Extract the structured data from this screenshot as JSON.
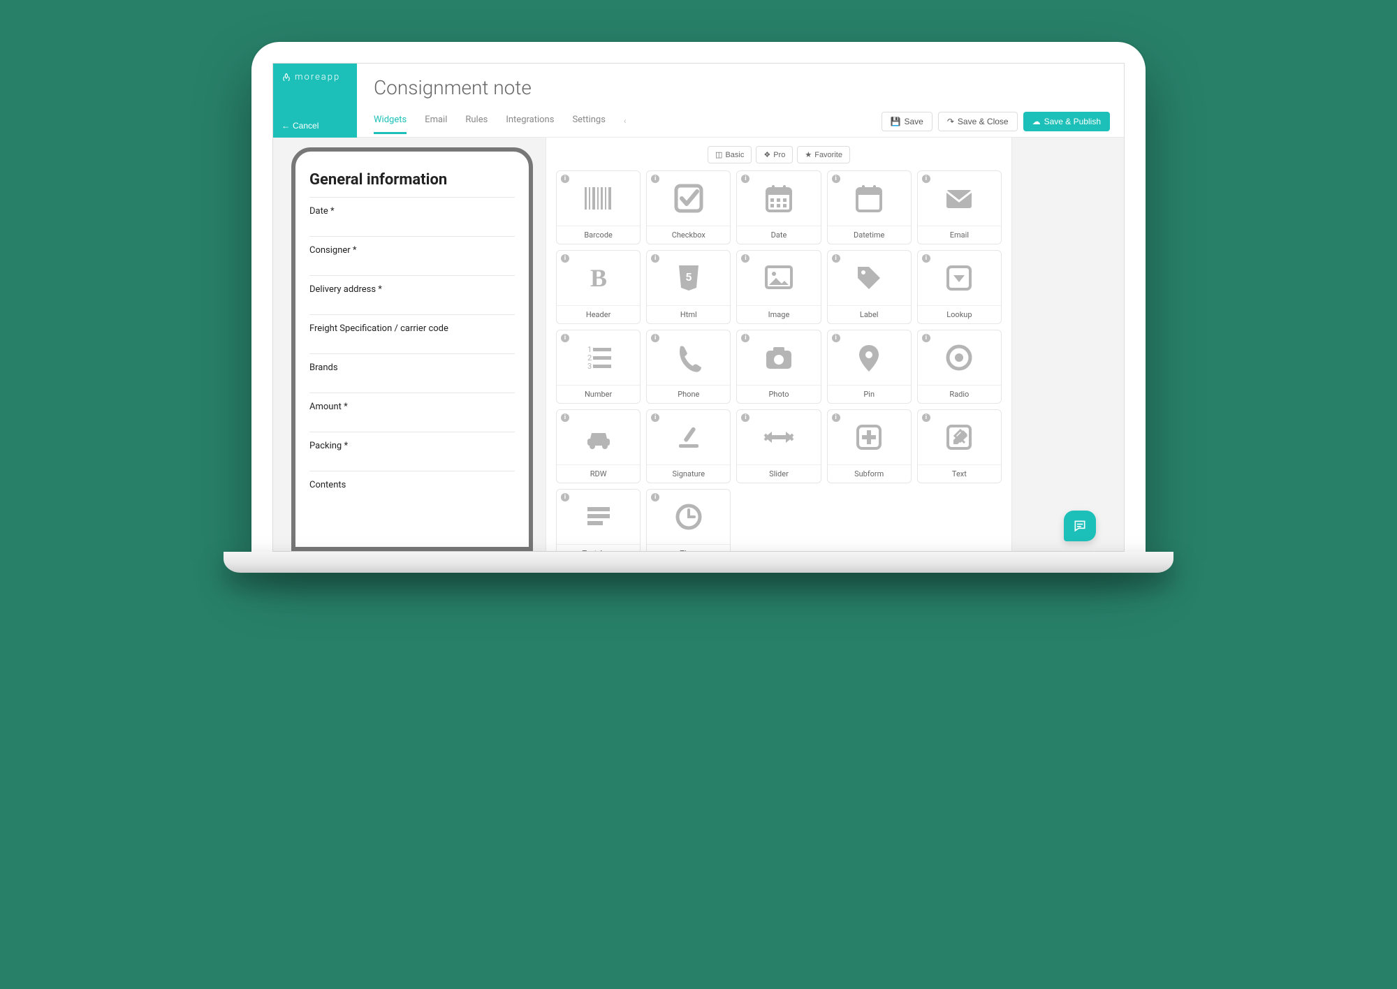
{
  "brand": "moreapp",
  "header": {
    "cancel": "Cancel",
    "title": "Consignment note",
    "tabs": [
      "Widgets",
      "Email",
      "Rules",
      "Integrations",
      "Settings"
    ],
    "active_tab": 0,
    "actions": {
      "save": "Save",
      "save_close": "Save & Close",
      "save_publish": "Save & Publish"
    }
  },
  "preview": {
    "section_title": "General information",
    "fields": [
      "Date *",
      "Consigner *",
      "Delivery address *",
      "Freight Specification / carrier code",
      "Brands",
      "Amount *",
      "Packing *",
      "Contents"
    ]
  },
  "widgets": {
    "tiers": [
      "Basic",
      "Pro",
      "Favorite"
    ],
    "items": [
      {
        "label": "Barcode",
        "icon": "barcode"
      },
      {
        "label": "Checkbox",
        "icon": "checkbox"
      },
      {
        "label": "Date",
        "icon": "date"
      },
      {
        "label": "Datetime",
        "icon": "datetime"
      },
      {
        "label": "Email",
        "icon": "email"
      },
      {
        "label": "Header",
        "icon": "header"
      },
      {
        "label": "Html",
        "icon": "html"
      },
      {
        "label": "Image",
        "icon": "image"
      },
      {
        "label": "Label",
        "icon": "label"
      },
      {
        "label": "Lookup",
        "icon": "lookup"
      },
      {
        "label": "Number",
        "icon": "number"
      },
      {
        "label": "Phone",
        "icon": "phone"
      },
      {
        "label": "Photo",
        "icon": "photo"
      },
      {
        "label": "Pin",
        "icon": "pin"
      },
      {
        "label": "Radio",
        "icon": "radio"
      },
      {
        "label": "RDW",
        "icon": "rdw"
      },
      {
        "label": "Signature",
        "icon": "signature"
      },
      {
        "label": "Slider",
        "icon": "slider"
      },
      {
        "label": "Subform",
        "icon": "subform"
      },
      {
        "label": "Text",
        "icon": "text"
      },
      {
        "label": "Text Area",
        "icon": "textarea"
      },
      {
        "label": "Time",
        "icon": "time"
      }
    ]
  }
}
